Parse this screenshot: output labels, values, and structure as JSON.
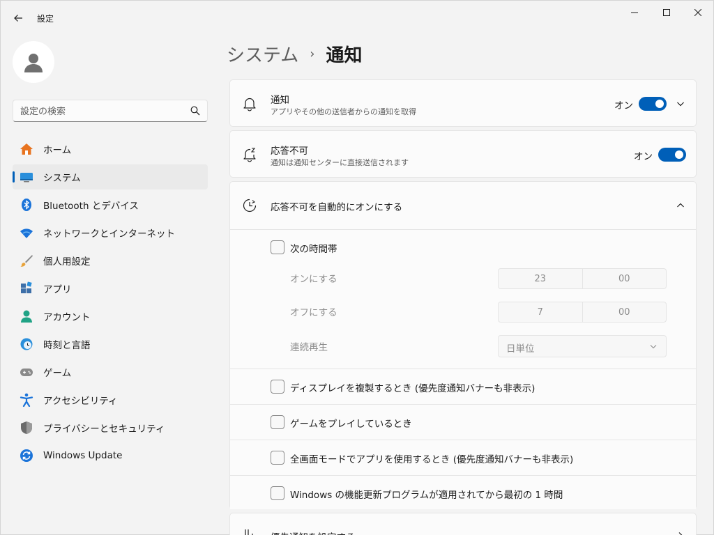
{
  "window": {
    "app_title": "設定"
  },
  "sidebar": {
    "search_placeholder": "設定の検索",
    "items": [
      {
        "label": "ホーム",
        "icon": "home-icon"
      },
      {
        "label": "システム",
        "icon": "system-icon",
        "selected": true
      },
      {
        "label": "Bluetooth とデバイス",
        "icon": "bluetooth-icon"
      },
      {
        "label": "ネットワークとインターネット",
        "icon": "network-icon"
      },
      {
        "label": "個人用設定",
        "icon": "brush-icon"
      },
      {
        "label": "アプリ",
        "icon": "apps-icon"
      },
      {
        "label": "アカウント",
        "icon": "account-icon"
      },
      {
        "label": "時刻と言語",
        "icon": "time-language-icon"
      },
      {
        "label": "ゲーム",
        "icon": "gaming-icon"
      },
      {
        "label": "アクセシビリティ",
        "icon": "accessibility-icon"
      },
      {
        "label": "プライバシーとセキュリティ",
        "icon": "shield-icon"
      },
      {
        "label": "Windows Update",
        "icon": "windows-update-icon"
      }
    ]
  },
  "breadcrumb": {
    "parent": "システム",
    "separator": "›",
    "current": "通知"
  },
  "cards": {
    "notifications": {
      "title": "通知",
      "subtitle": "アプリやその他の送信者からの通知を取得",
      "state": "オン",
      "enabled": true
    },
    "do_not_disturb": {
      "title": "応答不可",
      "subtitle": "通知は通知センターに直接送信されます",
      "state": "オン",
      "enabled": true
    },
    "auto_dnd": {
      "title": "応答不可を自動的にオンにする",
      "expanded": true,
      "time_range": {
        "label": "次の時間帯",
        "checked": false,
        "turn_on": {
          "label": "オンにする",
          "hour": "23",
          "minute": "00"
        },
        "turn_off": {
          "label": "オフにする",
          "hour": "7",
          "minute": "00"
        },
        "repeat": {
          "label": "連続再生",
          "value": "日単位"
        }
      },
      "options": [
        {
          "label": "ディスプレイを複製するとき (優先度通知バナーも非表示)",
          "checked": false
        },
        {
          "label": "ゲームをプレイしているとき",
          "checked": false
        },
        {
          "label": "全画面モードでアプリを使用するとき (優先度通知バナーも非表示)",
          "checked": false
        },
        {
          "label": "Windows の機能更新プログラムが適用されてから最初の 1 時間",
          "checked": false
        }
      ]
    },
    "priority": {
      "title": "優先通知を設定する"
    }
  },
  "colors": {
    "accent": "#005fb8",
    "background": "#f3f3f3",
    "card": "#fbfbfb"
  }
}
